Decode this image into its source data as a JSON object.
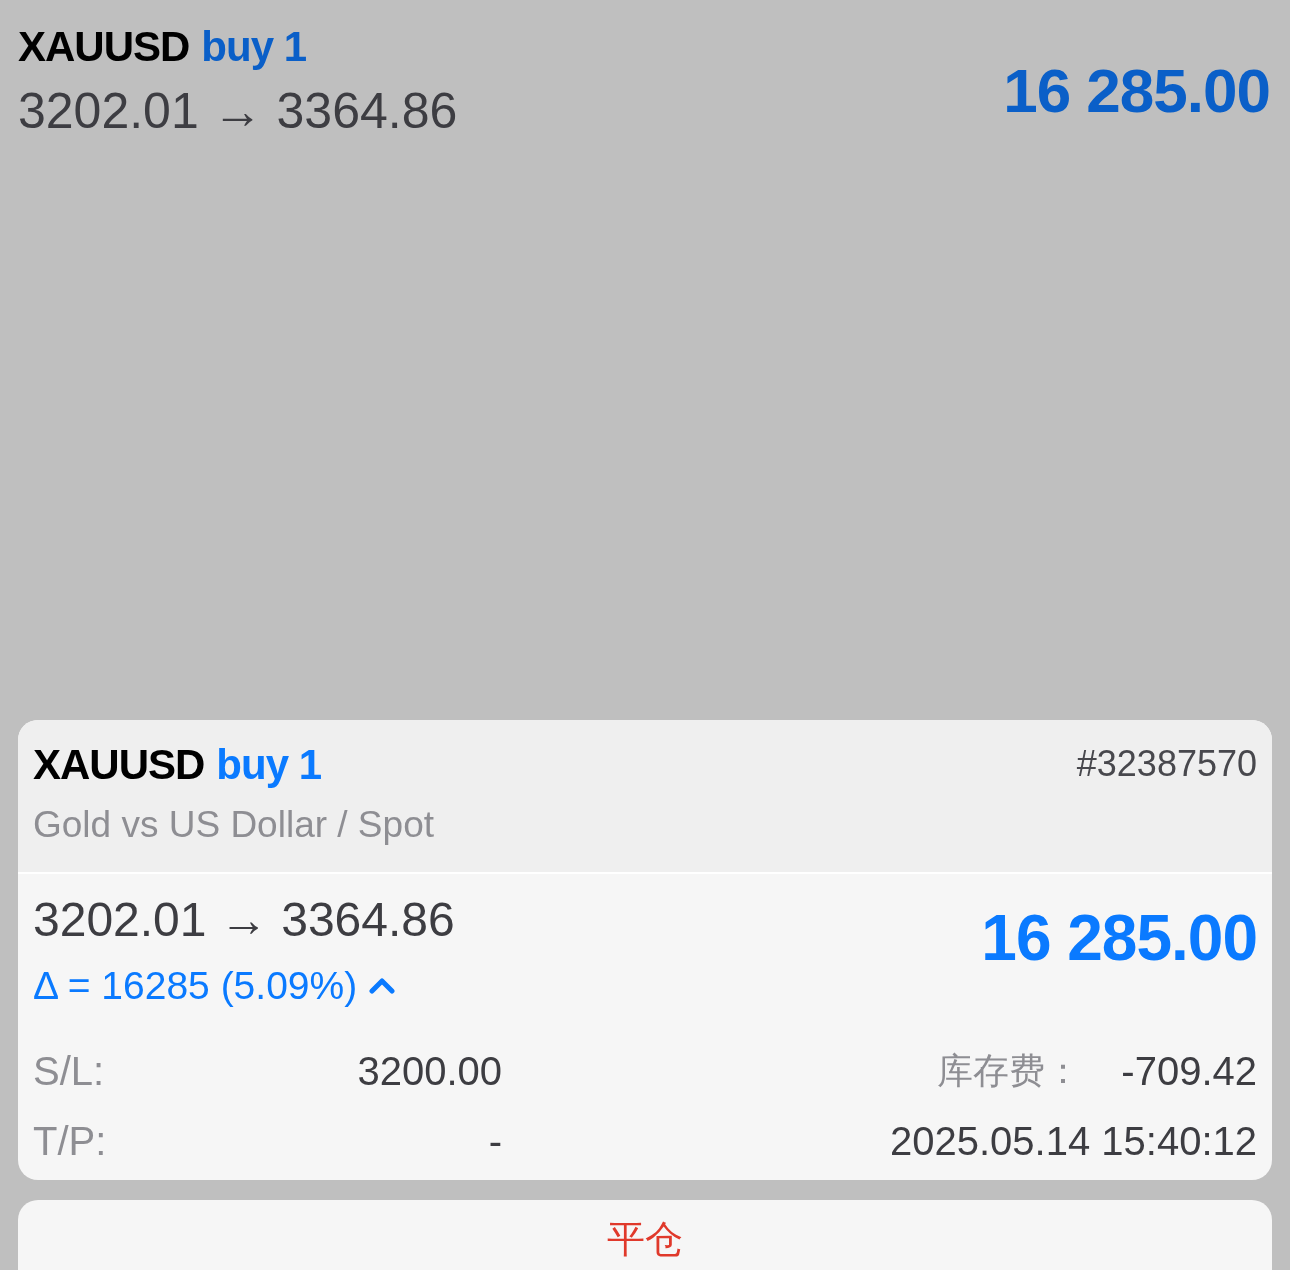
{
  "position": {
    "symbol": "XAUUSD",
    "side": "buy 1",
    "prices": "3202.01 → 3364.86",
    "profit": "16 285.00"
  },
  "card": {
    "symbol": "XAUUSD",
    "side": "buy 1",
    "ticket": "#32387570",
    "description": "Gold vs US Dollar / Spot",
    "prices": "3202.01 → 3364.86",
    "profit": "16 285.00",
    "change": "Δ = 16285 (5.09%)",
    "price_up": true,
    "rows": [
      {
        "left": {
          "label": "S/L:",
          "value": "3200.00"
        },
        "right": {
          "label": "库存费：",
          "value": "-709.42"
        }
      },
      {
        "left": {
          "label": "T/P:",
          "value": "-"
        },
        "right": {
          "value": "2025.05.14 15:40:12"
        }
      }
    ]
  },
  "close_button": {
    "label": "平仓"
  }
}
